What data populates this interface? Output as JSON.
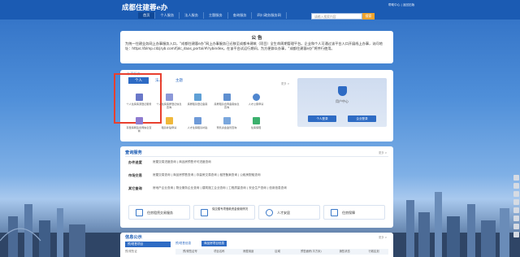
{
  "header": {
    "logo": "成都住建蓉e办",
    "nav": [
      "首页",
      "个人服务",
      "法人服务",
      "主题服务",
      "查询服务",
      "四川政务服务网"
    ],
    "search_placeholder": "请输入搜索内容",
    "search_button": "搜索",
    "top_links": "帮助中心 | 返回旧版"
  },
  "notice": {
    "title": "公 告",
    "body": "为统一住建业务网上办事服务入口，“成都住建蓉e办”网上办事服务已迁移至成都市建筑（项目）全生命周期管理平台。企业和个人可通过该平台入口开展线上办事，访问地址：https://blmp.cdzjryb.com/fjdc_daas_portal/#/rybindex。在该平台试运行期间，为方便群众办事，“成都住建蓉e办”将并行使用。"
  },
  "services": {
    "heading": "办事服务",
    "tabs": [
      "个人",
      "法人",
      "主题"
    ],
    "more": "更多 >",
    "items": [
      "个人住房房源登记服务",
      "个人住房房屋登记信息查询",
      "房屋租赁登记备案",
      "房屋租赁合同备案信息查询",
      "人才公寓申请",
      "存量房网签合同信息查询",
      "租赁补贴申请",
      "人才住房租赁补贴",
      "预售资金监管查询",
      "住房保障"
    ]
  },
  "user_center": {
    "title": "用户中心",
    "personal": "个人登录",
    "enterprise": "企业登录"
  },
  "query": {
    "title": "查询服务",
    "more": "更多 >",
    "rows": [
      {
        "label": "办件进度",
        "text": "房屋交易进度查询 | 商品房预售许可进度查询"
      },
      {
        "label": "市场交易",
        "text": "房屋交易查询 | 商品房预售查询 | 存量房交易查询 | 租赁备案查询 | 公租房配租查询"
      },
      {
        "label": "其它查询",
        "text": "房地产企业查询 | 物业服务企业查询 | 建筑施工企业查询 | 工程质量查询 | 安全生产查询 | 信用信息查询"
      }
    ],
    "cards": [
      "住房租赁交易服务",
      "保交楼专项借款资金使用情况",
      "人才安居",
      "住房保障"
    ]
  },
  "info": {
    "title": "信息公示",
    "more": "更多 >",
    "tabs": [
      "预/现售项目",
      "预/现售信息",
      "商品房项目信息"
    ],
    "columns": [
      "预/现售证号",
      "项目名称",
      "房屋用途",
      "区域",
      "预售面积(平方米)",
      "销售状态",
      "行政区划"
    ],
    "first_row": "预/现售证"
  },
  "colors": {
    "header": "#1b5bb3",
    "accent": "#2e6bc4",
    "highlight": "#e8402f"
  }
}
